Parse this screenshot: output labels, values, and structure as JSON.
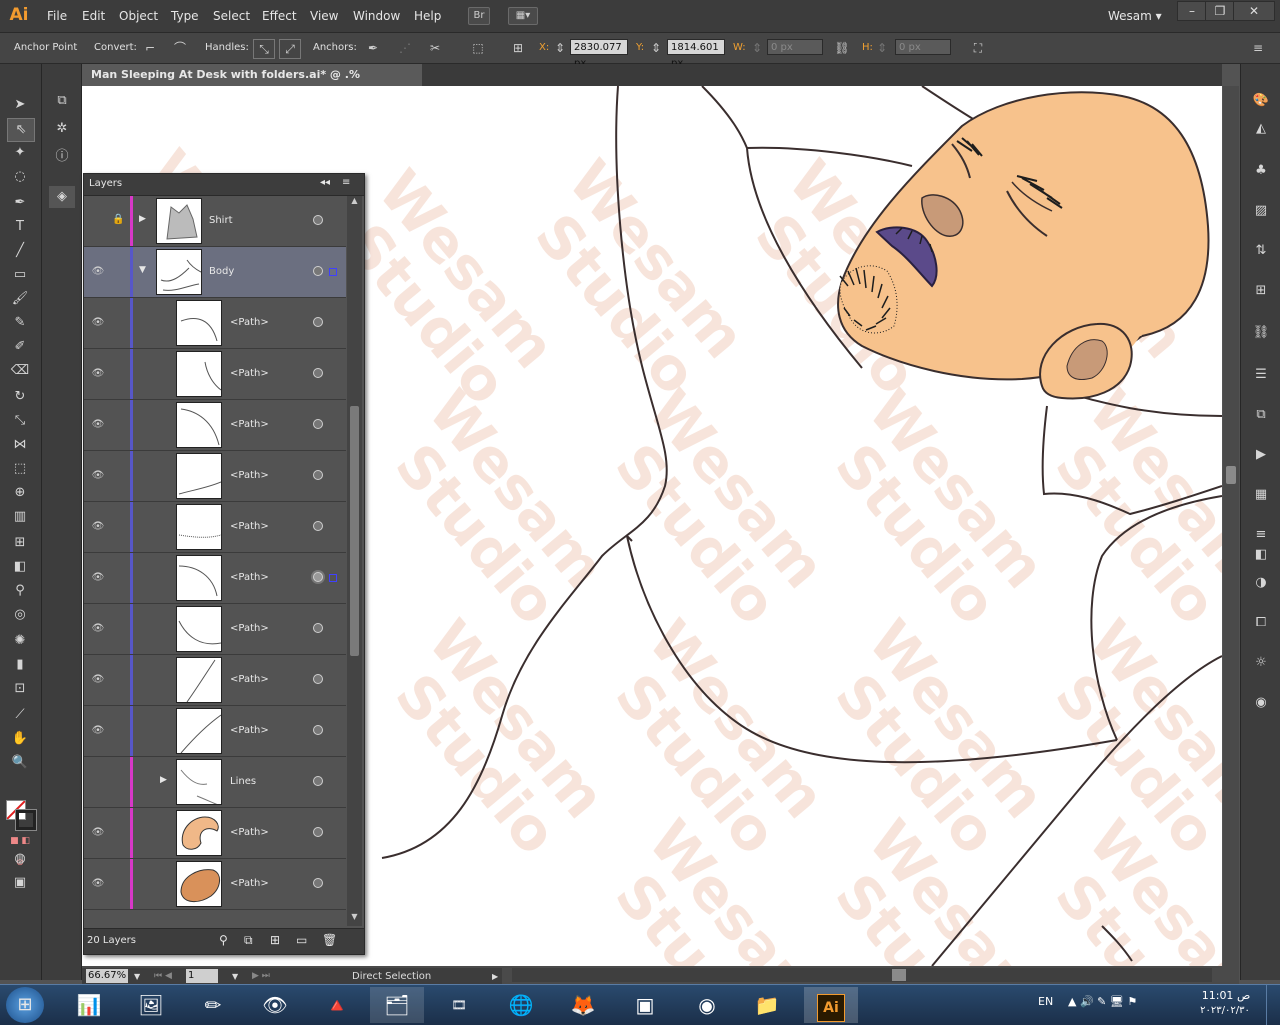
{
  "app": {
    "logo": "Ai",
    "user": "Wesam",
    "bridge_label": "Br"
  },
  "menu": [
    "File",
    "Edit",
    "Object",
    "Type",
    "Select",
    "Effect",
    "View",
    "Window",
    "Help"
  ],
  "control_bar": {
    "tool_label": "Anchor Point",
    "convert_label": "Convert:",
    "handles_label": "Handles:",
    "anchors_label": "Anchors:",
    "x_label": "X:",
    "x_value": "2830.077 px",
    "y_label": "Y:",
    "y_value": "1814.601 px",
    "w_label": "W:",
    "w_value": "0 px",
    "h_label": "H:",
    "h_value": "0 px"
  },
  "document": {
    "tab_title": "Man Sleeping At Desk with folders.ai* @ .% (RGB/Preview)",
    "close": "×"
  },
  "layers_panel": {
    "title": "Layers",
    "count_label": "20 Layers",
    "rows": [
      {
        "name": "Shirt",
        "locked": true,
        "expanded": false,
        "selected": false,
        "color": "#d838c8"
      },
      {
        "name": "Body",
        "locked": false,
        "expanded": true,
        "selected": true,
        "color": "#5757c8"
      },
      {
        "name": "<Path>",
        "color": "#5757c8"
      },
      {
        "name": "<Path>",
        "color": "#5757c8"
      },
      {
        "name": "<Path>",
        "color": "#5757c8"
      },
      {
        "name": "<Path>",
        "color": "#5757c8"
      },
      {
        "name": "<Path>",
        "color": "#5757c8"
      },
      {
        "name": "<Path>",
        "color": "#5757c8",
        "selected_target": true
      },
      {
        "name": "<Path>",
        "color": "#5757c8"
      },
      {
        "name": "<Path>",
        "color": "#5757c8"
      },
      {
        "name": "<Path>",
        "color": "#5757c8"
      },
      {
        "name": "Lines",
        "color": "#d838c8"
      },
      {
        "name": "<Path>",
        "color": "#d838c8"
      },
      {
        "name": "<Path>",
        "color": "#d838c8"
      }
    ]
  },
  "status": {
    "zoom": "66.67%",
    "artboard": "1",
    "tool": "Direct Selection"
  },
  "watermark": [
    "Wesam",
    "Studio"
  ],
  "taskbar": {
    "lang": "EN",
    "time": "11:01 ص",
    "date": "٢٠٢٣/٠٢/٣٠"
  },
  "colors": {
    "skin": "#f7c28c",
    "skin_shadow": "#c89a78",
    "lips": "#5b4a8a",
    "outline": "#3a2e2e",
    "accent": "#f29b2f",
    "selected_row": "#6b6f80"
  }
}
